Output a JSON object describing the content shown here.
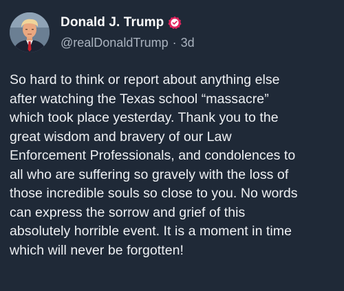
{
  "post": {
    "author": {
      "display_name": "Donald J. Trump",
      "handle": "@realDonaldTrump",
      "separator": "·",
      "age": "3d",
      "verified": true,
      "avatar_icon": "profile-photo",
      "badge_icon": "verified-badge-icon",
      "badge_color": "#e0245e"
    },
    "lines": [
      "So hard to think or report about anything else",
      "after watching the Texas school “massacre”",
      "which took place yesterday. Thank you to the",
      "great wisdom and bravery of our Law",
      "Enforcement Professionals, and condolences to",
      "all who are suffering so gravely with the loss of",
      "those incredible souls so close to you. No words",
      "can express the sorrow and grief of this",
      "absolutely horrible event. It is a moment in time",
      "which will never be forgotten!"
    ]
  },
  "theme": {
    "background": "#1f2937",
    "text": "#eef0f3",
    "secondary_text": "#aab3bf"
  }
}
